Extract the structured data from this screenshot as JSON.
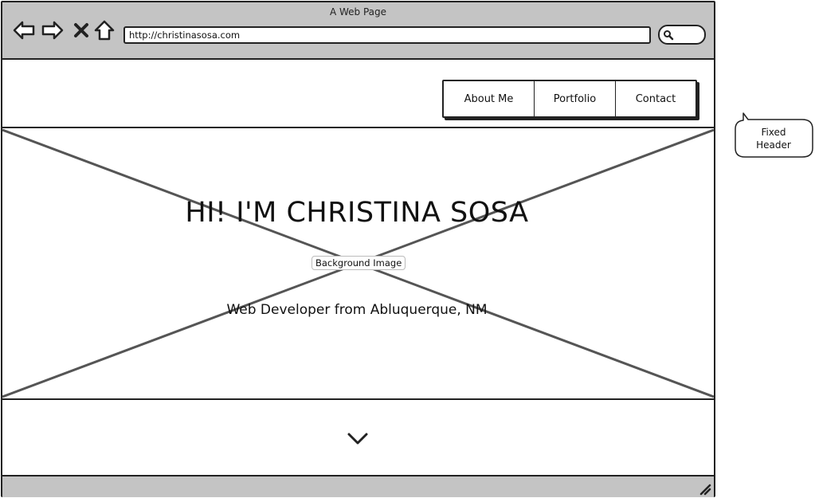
{
  "browser": {
    "window_title": "A Web Page",
    "url": "http://christinasosa.com"
  },
  "icons": {
    "back": "arrow-left-icon",
    "forward": "arrow-right-icon",
    "stop": "close-icon",
    "home": "home-icon",
    "search": "search-icon",
    "scroll_down": "chevron-down-icon",
    "resize": "resize-grip-icon"
  },
  "header": {
    "menu": [
      {
        "label": "About Me"
      },
      {
        "label": "Portfolio"
      },
      {
        "label": "Contact"
      }
    ]
  },
  "hero": {
    "title": "HI! I'M CHRISTINA SOSA",
    "image_label": "Background Image",
    "subtitle": "Web Developer from Abluquerque, NM"
  },
  "annotation": {
    "text": "Fixed\nHeader"
  },
  "colors": {
    "chrome": "#c4c4c4",
    "stroke": "#222222",
    "placeholder_lines": "#555555"
  }
}
